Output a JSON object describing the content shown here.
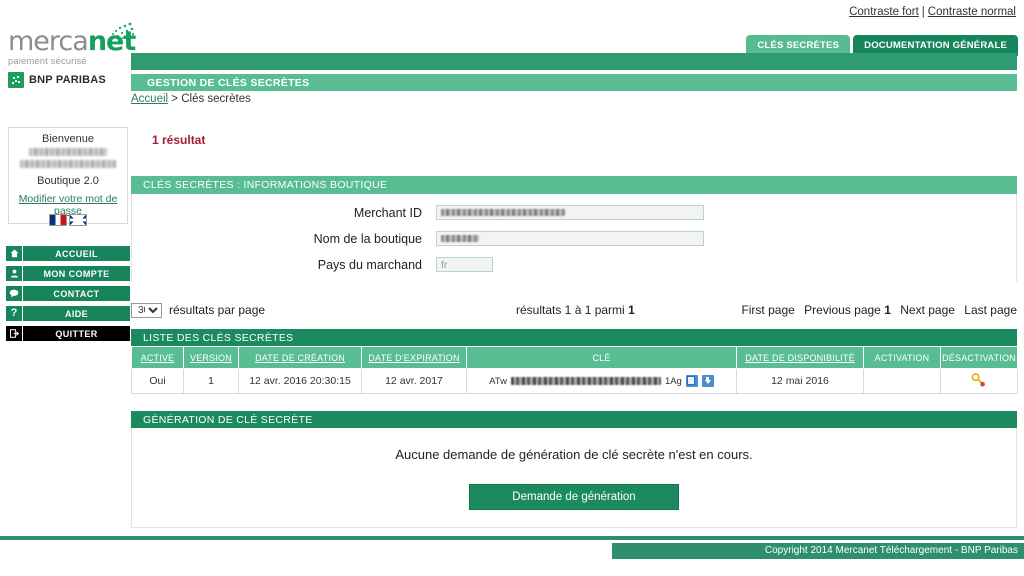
{
  "topbar": {
    "contrast_strong": "Contraste fort",
    "separator": "|",
    "contrast_normal": "Contraste normal"
  },
  "tabs": [
    {
      "label": "CLÉS SECRÈTES",
      "active": true
    },
    {
      "label": "DOCUMENTATION GÉNÉRALE",
      "active": false
    }
  ],
  "logo": {
    "word_main": "merca",
    "word_accent": "net",
    "tagline": "paiement sécurisé",
    "bank": "BNP PARIBAS"
  },
  "header": {
    "page_title": "GESTION DE CLÉS SECRÈTES",
    "breadcrumb_home": "Accueil",
    "breadcrumb_sep": ">",
    "breadcrumb_current": "Clés secrètes"
  },
  "sidebar": {
    "welcome": "Bienvenue",
    "user_line1": "",
    "user_line2": "",
    "shop": "Boutique 2.0",
    "change_password": "Modifier votre mot de passe",
    "flags": [
      "flag-fr",
      "flag-uk"
    ],
    "nav": [
      {
        "label": "ACCUEIL",
        "icon": "home-icon",
        "glyph": "⌂"
      },
      {
        "label": "MON COMPTE",
        "icon": "user-icon",
        "glyph": "●"
      },
      {
        "label": "CONTACT",
        "icon": "speech-bubble-icon",
        "glyph": "●"
      },
      {
        "label": "AIDE",
        "icon": "question-mark-icon",
        "glyph": "?"
      },
      {
        "label": "QUITTER",
        "icon": "exit-icon",
        "glyph": "→"
      }
    ]
  },
  "main": {
    "result_count": "1 résultat",
    "shop_panel": {
      "title": "CLÉS SECRÈTES  :  INFORMATIONS BOUTIQUE",
      "fields": [
        {
          "label": "Merchant ID",
          "value": "",
          "redacted": true,
          "width": "long"
        },
        {
          "label": "Nom de la boutique",
          "value": "",
          "redacted": true,
          "width": "long"
        },
        {
          "label": "Pays du marchand",
          "value": "fr",
          "redacted": false,
          "width": "short"
        }
      ]
    },
    "pagination": {
      "per_page_value": "30",
      "per_page_options": [
        "30"
      ],
      "per_page_label": "résultats par page",
      "range_text": "résultats 1 à 1 parmi ",
      "range_total": "1",
      "first_page": "First page",
      "previous_page": "Previous page",
      "current_page": "1",
      "next_page": "Next page",
      "last_page": "Last page"
    },
    "table": {
      "title": "LISTE DES CLÉS SECRÈTES",
      "columns": [
        {
          "label": "ACTIVE",
          "sortable": true
        },
        {
          "label": "VERSION",
          "sortable": true
        },
        {
          "label": "DATE DE CRÉATION",
          "sortable": true
        },
        {
          "label": "DATE D'EXPIRATION",
          "sortable": true
        },
        {
          "label": "CLÉ",
          "sortable": false
        },
        {
          "label": "DATE DE DISPONIBILITÉ",
          "sortable": true
        },
        {
          "label": "ACTIVATION",
          "sortable": false
        },
        {
          "label": "DÉSACTIVATION",
          "sortable": false
        }
      ],
      "rows": [
        {
          "active": "Oui",
          "version": "1",
          "creation_date": "12 avr. 2016 20:30:15",
          "expiration_date": "12 avr. 2017",
          "key_prefix": "ATw",
          "key_suffix": "1Ag",
          "availability_date": "12 mai 2016",
          "activation": "",
          "deactivation_icon": "key-disable-icon"
        }
      ]
    },
    "generation": {
      "title": "GÉNÉRATION DE CLÉ SECRÈTE",
      "message": "Aucune demande de génération de clé secrète n'est en cours.",
      "button": "Demande de génération"
    }
  },
  "footer": {
    "copyright": "Copyright 2014 Mercanet Téléchargement - BNP Paribas"
  },
  "colors": {
    "green_dark": "#17845b",
    "green_mid": "#2e9b72",
    "green_light": "#59bd93",
    "accent_red": "#9b1f39",
    "icon_blue": "#4c8fd0"
  }
}
